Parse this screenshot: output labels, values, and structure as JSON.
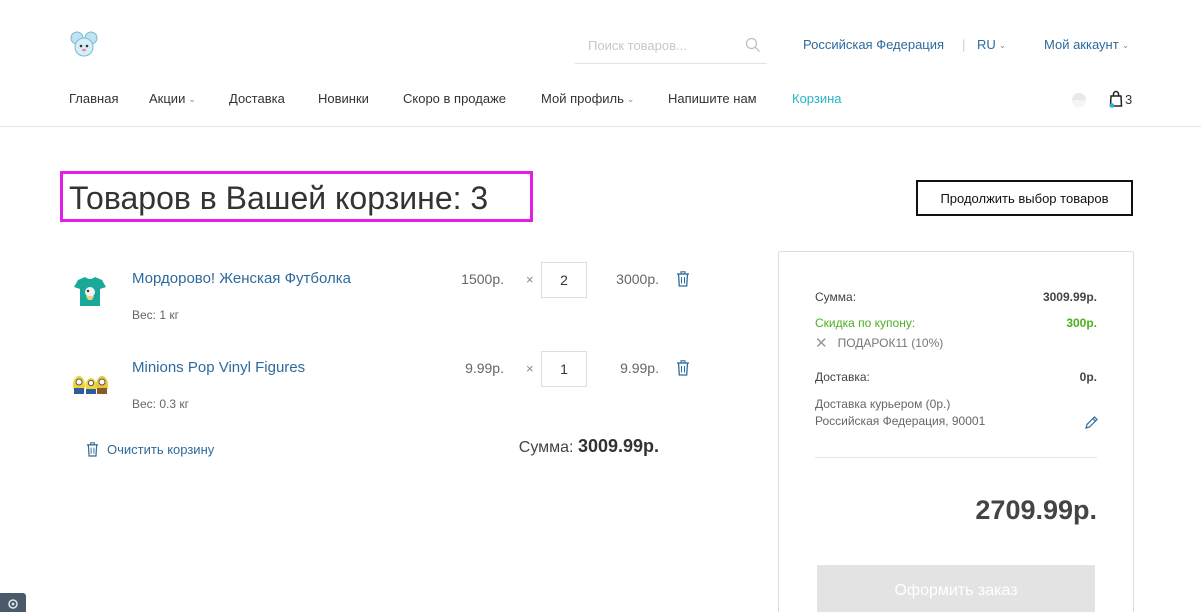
{
  "header": {
    "search_placeholder": "Поиск товаров...",
    "region": "Российская Федерация",
    "language": "RU",
    "account": "Мой аккаунт"
  },
  "nav": {
    "items": [
      {
        "label": "Главная",
        "has_dropdown": false
      },
      {
        "label": "Акции",
        "has_dropdown": true
      },
      {
        "label": "Доставка",
        "has_dropdown": false
      },
      {
        "label": "Новинки",
        "has_dropdown": false
      },
      {
        "label": "Скоро в продаже",
        "has_dropdown": false
      },
      {
        "label": "Мой профиль",
        "has_dropdown": true
      },
      {
        "label": "Напишите нам",
        "has_dropdown": false
      },
      {
        "label": "Корзина",
        "has_dropdown": false,
        "active": true
      }
    ],
    "cart_count": "3"
  },
  "page": {
    "title": "Товаров в Вашей корзине: 3",
    "continue_label": "Продолжить выбор товаров"
  },
  "cart": {
    "items": [
      {
        "name": "Мордорово! Женская Футболка",
        "weight": "Вес: 1 кг",
        "price": "1500р.",
        "quantity": "2",
        "total": "3000р."
      },
      {
        "name": "Minions Pop Vinyl Figures",
        "weight": "Вес: 0.3 кг",
        "price": "9.99р.",
        "quantity": "1",
        "total": "9.99р."
      }
    ],
    "multiply_sign": "×",
    "clear_label": "Очистить корзину",
    "subtotal_label": "Сумма:",
    "subtotal_value": "3009.99р."
  },
  "summary": {
    "sum_label": "Сумма:",
    "sum_value": "3009.99р.",
    "discount_label": "Скидка по купону:",
    "discount_value": "300р.",
    "coupon_code": "ПОДАРОК11 (10%)",
    "delivery_label": "Доставка:",
    "delivery_value": "0р.",
    "delivery_method": "Доставка курьером (0р.)",
    "delivery_address": "Российская Федерация, 90001",
    "grand_total": "2709.99р.",
    "order_label": "Оформить заказ"
  },
  "colors": {
    "link": "#2e6a9c",
    "active_nav": "#27b4c6",
    "discount": "#4caf1f",
    "highlight_border": "#e21fe6",
    "order_button_bg": "#e3e3e3"
  }
}
